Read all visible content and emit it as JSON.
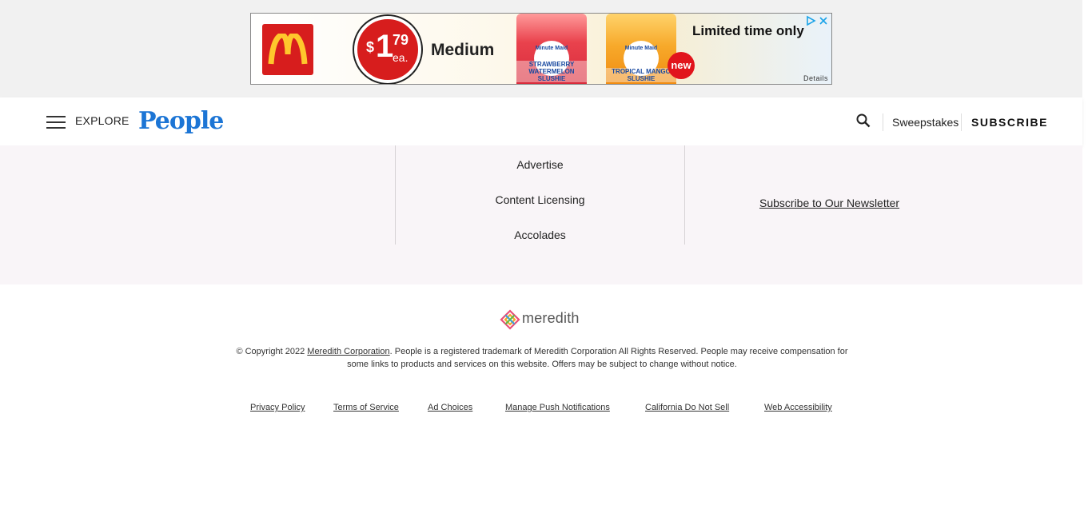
{
  "ad": {
    "price_dollar": "$",
    "price_main": "1",
    "price_cents": "79",
    "price_unit": "ea.",
    "size_label": "Medium",
    "brand_left": "Minute Maid",
    "flavor_left": "STRAWBERRY WATERMELON SLUSHIE",
    "brand_right": "Minute Maid",
    "flavor_right": "TROPICAL MANGO SLUSHIE",
    "new_badge": "new",
    "headline": "Limited time only",
    "details": "Details"
  },
  "header": {
    "explore_label": "EXPLORE",
    "logo_text": "People",
    "sweepstakes_label": "Sweepstakes",
    "subscribe_label": "SUBSCRIBE",
    "logo_color": "#1c75d5"
  },
  "footer": {
    "links_center": [
      "Advertise",
      "Content Licensing",
      "Accolades"
    ],
    "newsletter_label": "Subscribe to Our Newsletter",
    "brand_name": "meredith",
    "copyright_prefix": "© Copyright 2022 ",
    "copyright_link": "Meredith Corporation",
    "copyright_rest": ". People is a registered trademark of Meredith Corporation All Rights Reserved. People may receive compensation for some links to products and services on this website. Offers may be subject to change without notice.",
    "legal_links": [
      "Privacy Policy",
      "Terms of Service",
      "Ad Choices",
      "Manage Push Notifications",
      "California Do Not Sell",
      "Web Accessibility"
    ]
  }
}
